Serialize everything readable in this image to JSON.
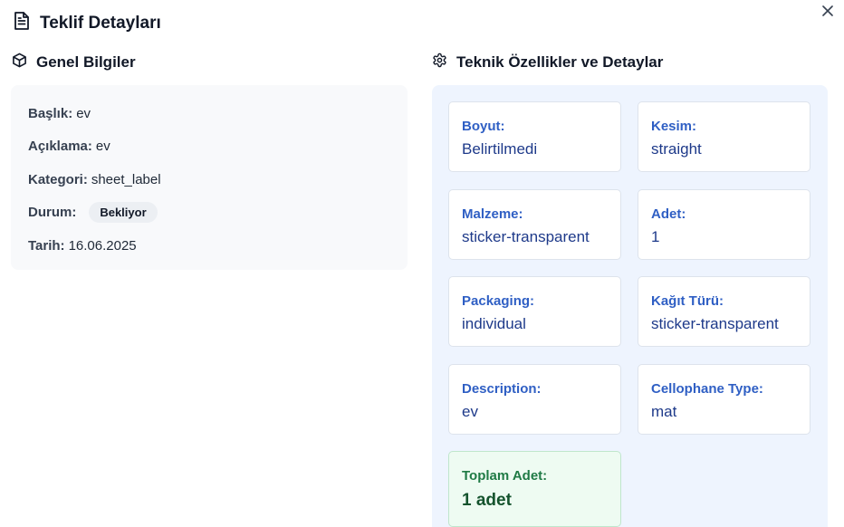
{
  "dialog": {
    "title": "Teklif Detayları"
  },
  "general": {
    "title": "Genel Bilgiler",
    "rows": [
      {
        "label": "Başlık:",
        "value": "ev"
      },
      {
        "label": "Açıklama:",
        "value": "ev"
      },
      {
        "label": "Kategori:",
        "value": "sheet_label"
      },
      {
        "label": "Durum:",
        "value": "Bekliyor"
      },
      {
        "label": "Tarih:",
        "value": "16.06.2025"
      }
    ]
  },
  "technical": {
    "title": "Teknik Özellikler ve Detaylar",
    "tiles": [
      {
        "label": "Boyut:",
        "value": "Belirtilmedi"
      },
      {
        "label": "Kesim:",
        "value": "straight"
      },
      {
        "label": "Malzeme:",
        "value": "sticker-transparent"
      },
      {
        "label": "Adet:",
        "value": "1"
      },
      {
        "label": "Packaging:",
        "value": "individual"
      },
      {
        "label": "Kağıt Türü:",
        "value": "sticker-transparent"
      },
      {
        "label": "Description:",
        "value": "ev"
      },
      {
        "label": "Cellophane Type:",
        "value": "mat"
      }
    ],
    "total": {
      "label": "Toplam Adet:",
      "value": "1 adet"
    }
  },
  "icons": {
    "header": "document-icon",
    "general": "cube-icon",
    "technical": "gear-icon",
    "close": "close-icon"
  },
  "colors": {
    "tile_label": "#2f5fc4",
    "tile_value": "#1e3a8a",
    "panel_bg": "#eef4fe",
    "total_bg": "#eefbf2",
    "total_label": "#1f7a45"
  }
}
